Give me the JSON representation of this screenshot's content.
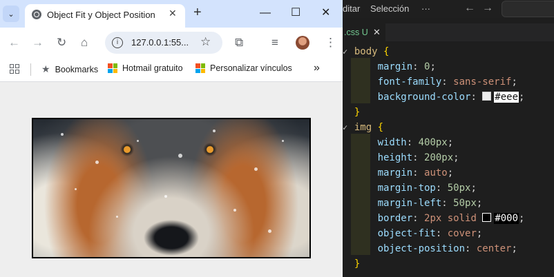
{
  "browser": {
    "tab_title": "Object Fit y Object Position",
    "url": "127.0.0.1:55...",
    "bookmarks": [
      {
        "label": "Bookmarks"
      },
      {
        "label": "Hotmail gratuito"
      },
      {
        "label": "Personalizar vínculos"
      }
    ],
    "more_bookmarks": "»",
    "image_alt": "wolf-face-photo"
  },
  "editor": {
    "menu": [
      "ditar",
      "Selección",
      "···"
    ],
    "tab_label": ".css U",
    "tab_close": "✕",
    "code": {
      "body_selector": "body",
      "img_selector": "img",
      "open_brace": "{",
      "close_brace": "}",
      "body_props": [
        {
          "prop": "margin",
          "value": "0"
        },
        {
          "prop": "font-family",
          "value": "sans-serif"
        },
        {
          "prop": "background-color",
          "value": "#eee",
          "swatch": "#eeeeee"
        }
      ],
      "img_props": [
        {
          "prop": "width",
          "value": "400px"
        },
        {
          "prop": "height",
          "value": "200px"
        },
        {
          "prop": "margin",
          "value": "auto"
        },
        {
          "prop": "margin-top",
          "value": "50px"
        },
        {
          "prop": "margin-left",
          "value": "50px"
        },
        {
          "prop": "border",
          "value": "2px solid",
          "hex": "#000",
          "swatch": "#000000"
        },
        {
          "prop": "object-fit",
          "value": "cover"
        },
        {
          "prop": "object-position",
          "value": "center"
        }
      ]
    }
  },
  "colors": {
    "tabstrip": "#d3e3fd",
    "page_background": "#eeeeee",
    "editor_background": "#1e1e1e"
  }
}
